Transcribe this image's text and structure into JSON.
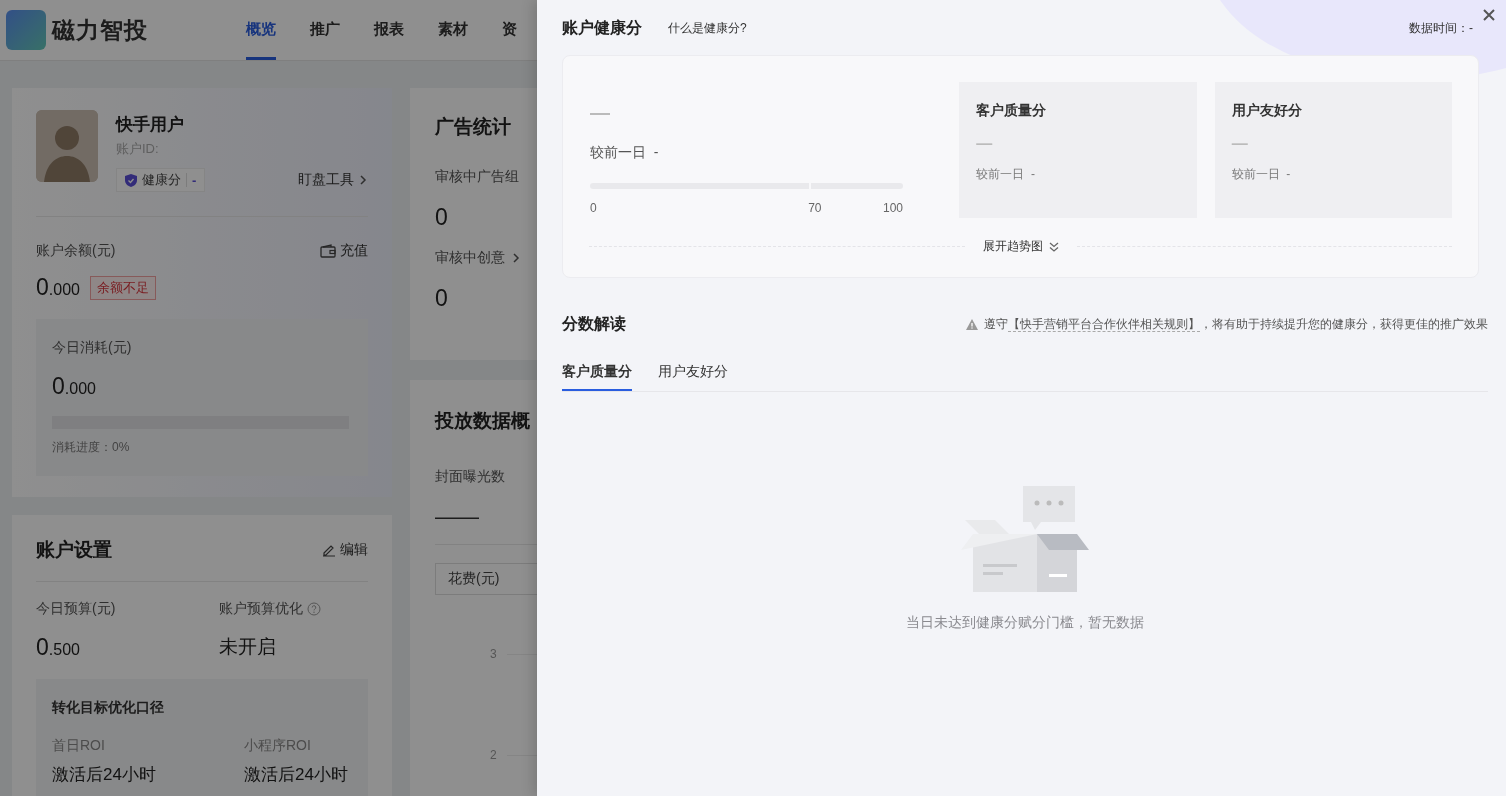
{
  "header": {
    "logo_text": "磁力智投",
    "nav": [
      {
        "label": "概览",
        "selected": true
      },
      {
        "label": "推广",
        "selected": false
      },
      {
        "label": "报表",
        "selected": false
      },
      {
        "label": "素材",
        "selected": false
      },
      {
        "label": "资",
        "selected": false
      }
    ]
  },
  "account_card": {
    "user_name": "快手用户",
    "account_id_label": "账户ID:",
    "health_label": "健康分",
    "health_value": "-",
    "tool_link": "盯盘工具",
    "balance_label": "账户余额(元)",
    "recharge": "充值",
    "balance": "0.000",
    "balance_warning": "余额不足",
    "today_cost": {
      "label": "今日消耗(元)",
      "value": "0.000",
      "level": 0,
      "progress_text": "消耗进度：0%"
    }
  },
  "ad_stats": {
    "title": "广告统计",
    "items": [
      {
        "label": "审核中广告组",
        "value": "0",
        "link": false
      },
      {
        "label": "审核中创意",
        "value": "0",
        "link": true
      }
    ]
  },
  "account_settings": {
    "title": "账户设置",
    "edit": "编辑",
    "fields": [
      {
        "label": "今日预算(元)",
        "value": "0.500",
        "kind": "amount",
        "help": false
      },
      {
        "label": "账户预算优化",
        "value": "未开启",
        "kind": "text",
        "help": true
      }
    ],
    "conversion": {
      "title": "转化目标优化口径",
      "items": [
        {
          "label": "首日ROI",
          "value": "激活后24小时"
        },
        {
          "label": "小程序ROI",
          "value": "激活后24小时"
        }
      ]
    }
  },
  "delivery_overview": {
    "title": "投放数据概",
    "metric_label": "封面曝光数",
    "metric_value": "——",
    "select_value": "花费(元)",
    "axis_ticks": [
      "3",
      "2"
    ]
  },
  "drawer": {
    "title": "账户健康分",
    "help_link": "什么是健康分?",
    "data_time": "数据时间：-",
    "score": {
      "value": "—",
      "compare": "较前一日  -",
      "scale": [
        "0",
        "70",
        "100"
      ]
    },
    "sub_scores": [
      {
        "title": "客户质量分",
        "value": "—",
        "compare": "较前一日  -"
      },
      {
        "title": "用户友好分",
        "value": "—",
        "compare": "较前一日  -"
      }
    ],
    "expand": "展开趋势图",
    "section_title": "分数解读",
    "notice": {
      "prefix": "遵守",
      "link": "【快手营销平台合作伙伴相关规则】",
      "suffix": "，将有助于持续提升您的健康分，获得更佳的推广效果"
    },
    "tabs": [
      {
        "label": "客户质量分",
        "selected": true
      },
      {
        "label": "用户友好分",
        "selected": false
      }
    ],
    "empty_text": "当日未达到健康分赋分门槛，暂无数据"
  }
}
